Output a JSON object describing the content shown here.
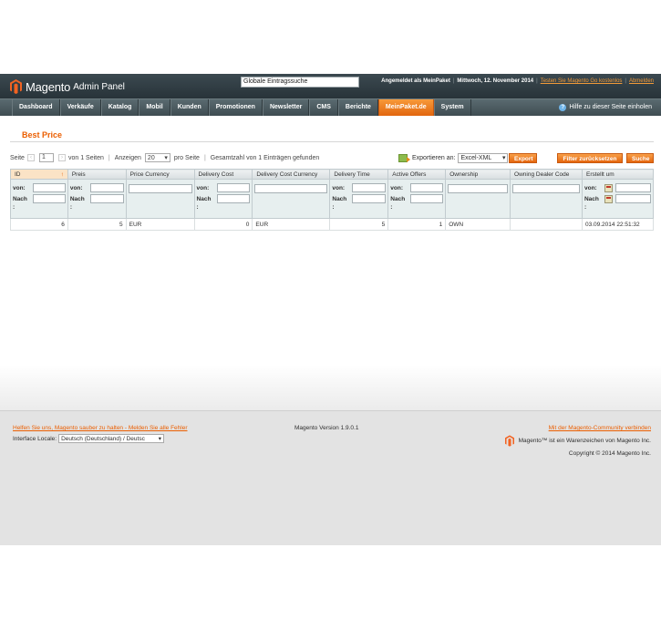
{
  "header": {
    "logo_text": "Magento",
    "logo_sub": "Admin Panel",
    "global_search_value": "Globale Eintragssuche",
    "logged_in": "Angemeldet als MeinPaket",
    "date": "Mittwoch, 12. November 2014",
    "try_link": "Testen Sie Magento Go kostenlos",
    "logout_link": "Abmelden"
  },
  "nav": {
    "items": [
      {
        "label": "Dashboard"
      },
      {
        "label": "Verkäufe"
      },
      {
        "label": "Katalog"
      },
      {
        "label": "Mobil"
      },
      {
        "label": "Kunden"
      },
      {
        "label": "Promotionen"
      },
      {
        "label": "Newsletter"
      },
      {
        "label": "CMS"
      },
      {
        "label": "Berichte"
      },
      {
        "label": "MeinPaket.de"
      },
      {
        "label": "System"
      }
    ],
    "active": "MeinPaket.de",
    "help_label": "Hilfe zu dieser Seite einholen"
  },
  "page": {
    "title": "Best Price"
  },
  "pager": {
    "page_label": "Seite",
    "page_value": "1",
    "of_pages": "von 1 Seiten",
    "show_label": "Anzeigen",
    "per_page_value": "20",
    "per_page_suffix": "pro Seite",
    "total": "Gesamtzahl von 1 Einträgen gefunden"
  },
  "export": {
    "label": "Exportieren an:",
    "format": "Excel-XML",
    "button": "Export"
  },
  "actions": {
    "reset_filter": "Filter zurücksetzen",
    "search": "Suche"
  },
  "grid": {
    "columns": [
      "ID",
      "Preis",
      "Price Currency",
      "Delivery Cost",
      "Delivery Cost Currency",
      "Delivery Time",
      "Active Offers",
      "Ownership",
      "Owning Dealer Code",
      "Erstellt um"
    ],
    "sort_arrow": "↑",
    "filter_from": "von:",
    "filter_to": "Nach",
    "filter_colon": ":",
    "rows": [
      [
        "6",
        "5",
        "EUR",
        "0",
        "EUR",
        "5",
        "1",
        "OWN",
        "",
        "03.09.2014 22:51:32"
      ]
    ]
  },
  "footer": {
    "help_link": "Helfen Sie uns, Magento sauber zu halten - Melden Sie alle Fehler",
    "locale_label": "Interface Locale:",
    "locale_value": "Deutsch (Deutschland) / Deutsc",
    "version": "Magento Version 1.9.0.1",
    "community_link": "Mit der Magento-Community verbinden",
    "trademark": "Magento™ ist ein Warenzeichen von Magento Inc.",
    "copyright": "Copyright © 2014 Magento Inc."
  },
  "colors": {
    "accent": "#eb5e00",
    "header_bg": "#2f3b41",
    "nav_active": "#f18a2a"
  }
}
